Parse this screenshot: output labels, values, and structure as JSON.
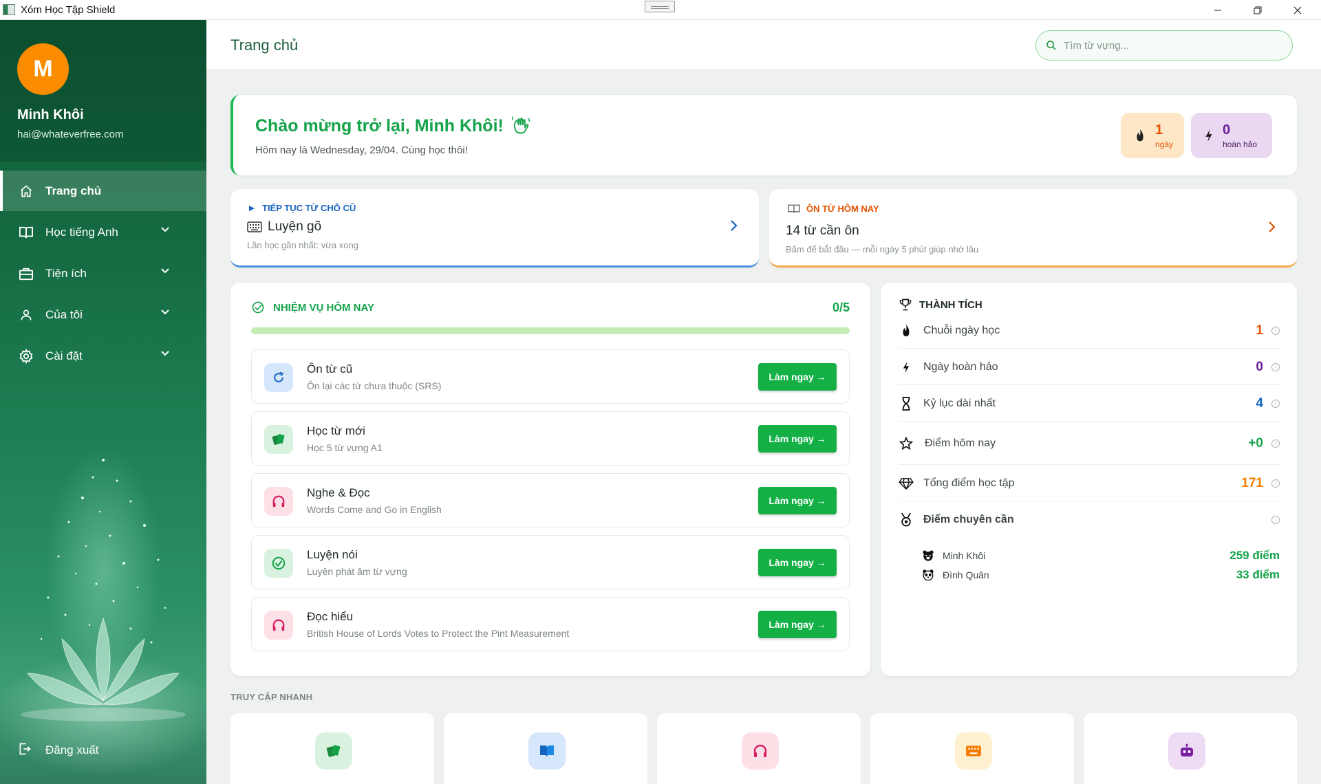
{
  "window": {
    "title": "Xóm Học Tập Shield"
  },
  "user": {
    "initial": "M",
    "name": "Minh Khôi",
    "email": "hai@whateverfree.com"
  },
  "nav": [
    {
      "label": "Trang chủ",
      "icon": "home-icon",
      "active": true
    },
    {
      "label": "Học tiếng Anh",
      "icon": "book-open-icon"
    },
    {
      "label": "Tiện ích",
      "icon": "toolbox-icon"
    },
    {
      "label": "Của tôi",
      "icon": "user-icon"
    },
    {
      "label": "Cài đặt",
      "icon": "gear-icon"
    }
  ],
  "logout": {
    "label": "Đăng xuất"
  },
  "header": {
    "title": "Trang chủ",
    "search_placeholder": "Tìm từ vựng..."
  },
  "welcome": {
    "title": "Chào mừng trở lại, Minh Khôi!",
    "subtitle": "Hôm nay là Wednesday, 29/04. Cùng học thôi!",
    "streak": {
      "value": "1",
      "label": "ngày"
    },
    "perfect": {
      "value": "0",
      "label": "hoàn hảo"
    }
  },
  "continue_card": {
    "kicker": "TIẾP TỤC TỪ CHỖ CŨ",
    "title": "Luyện gõ",
    "subtitle": "Lần học gần nhất: vừa xong"
  },
  "review_card": {
    "kicker": "ÔN TỪ HÔM NAY",
    "title": "14 từ cần ôn",
    "subtitle": "Bấm để bắt đầu — mỗi ngày 5 phút giúp nhớ lâu"
  },
  "tasks": {
    "title": "NHIỆM VỤ HÔM NAY",
    "count": "0/5",
    "progress_fraction": 0,
    "action_label": "Làm ngay →",
    "items": [
      {
        "name": "Ôn từ cũ",
        "desc": "Ôn lại các từ chưa thuộc (SRS)",
        "icon": "refresh-icon"
      },
      {
        "name": "Học từ mới",
        "desc": "Học 5 từ vựng A1",
        "icon": "cards-icon"
      },
      {
        "name": "Nghe & Đọc",
        "desc": "Words Come and Go in English",
        "icon": "headphones-icon"
      },
      {
        "name": "Luyện nói",
        "desc": "Luyện phát âm từ vựng",
        "icon": "check-circle-icon"
      },
      {
        "name": "Đọc hiểu",
        "desc": "British House of Lords Votes to Protect the Pint Measurement",
        "icon": "headphones-icon"
      }
    ]
  },
  "achievements": {
    "title": "THÀNH TÍCH",
    "rows": [
      {
        "label": "Chuỗi ngày học",
        "value": "1",
        "color": "#e65100",
        "icon": "flame-icon"
      },
      {
        "label": "Ngày hoàn hảo",
        "value": "0",
        "color": "#6a1b9a",
        "icon": "bolt-icon"
      },
      {
        "label": "Kỷ lục dài nhất",
        "value": "4",
        "color": "#1565c0",
        "icon": "hourglass-icon"
      },
      {
        "label": "Điểm hôm nay",
        "value": "+0",
        "color": "#14a34a",
        "icon": "star-icon"
      },
      {
        "label": "Tổng điểm học tập",
        "value": "171",
        "color": "#f57c00",
        "icon": "diamond-icon"
      }
    ],
    "diligence": {
      "label": "Điểm chuyên cần",
      "members": [
        {
          "name": "Minh Khôi",
          "points": "259 điểm",
          "icon": "bear-icon"
        },
        {
          "name": "Đình Quân",
          "points": "33 điểm",
          "icon": "panda-icon"
        }
      ]
    }
  },
  "quick_access": {
    "title": "TRUY CẬP NHANH",
    "items": [
      {
        "icon": "cards-icon",
        "bg": "#d9f2df"
      },
      {
        "icon": "book-open-icon",
        "bg": "#d6e6fb"
      },
      {
        "icon": "headphones-icon",
        "bg": "#fde0e6"
      },
      {
        "icon": "keyboard-icon",
        "bg": "#fff1cf"
      },
      {
        "icon": "robot-icon",
        "bg": "#eedcf5"
      }
    ]
  }
}
